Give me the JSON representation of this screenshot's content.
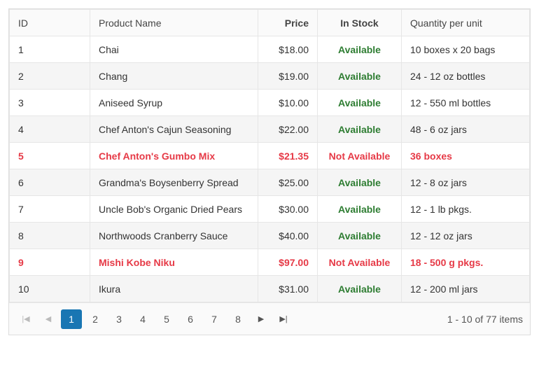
{
  "columns": {
    "id": "ID",
    "name": "Product Name",
    "price": "Price",
    "stock": "In Stock",
    "qty": "Quantity per unit"
  },
  "stock_labels": {
    "available": "Available",
    "not_available": "Not Available"
  },
  "rows": [
    {
      "id": "1",
      "name": "Chai",
      "price": "$18.00",
      "available": true,
      "qty": "10 boxes x 20 bags"
    },
    {
      "id": "2",
      "name": "Chang",
      "price": "$19.00",
      "available": true,
      "qty": "24 - 12 oz bottles"
    },
    {
      "id": "3",
      "name": "Aniseed Syrup",
      "price": "$10.00",
      "available": true,
      "qty": "12 - 550 ml bottles"
    },
    {
      "id": "4",
      "name": "Chef Anton's Cajun Seasoning",
      "price": "$22.00",
      "available": true,
      "qty": "48 - 6 oz jars"
    },
    {
      "id": "5",
      "name": "Chef Anton's Gumbo Mix",
      "price": "$21.35",
      "available": false,
      "qty": "36 boxes"
    },
    {
      "id": "6",
      "name": "Grandma's Boysenberry Spread",
      "price": "$25.00",
      "available": true,
      "qty": "12 - 8 oz jars"
    },
    {
      "id": "7",
      "name": "Uncle Bob's Organic Dried Pears",
      "price": "$30.00",
      "available": true,
      "qty": "12 - 1 lb pkgs."
    },
    {
      "id": "8",
      "name": "Northwoods Cranberry Sauce",
      "price": "$40.00",
      "available": true,
      "qty": "12 - 12 oz jars"
    },
    {
      "id": "9",
      "name": "Mishi Kobe Niku",
      "price": "$97.00",
      "available": false,
      "qty": "18 - 500 g pkgs."
    },
    {
      "id": "10",
      "name": "Ikura",
      "price": "$31.00",
      "available": true,
      "qty": "12 - 200 ml jars"
    }
  ],
  "pager": {
    "pages": [
      "1",
      "2",
      "3",
      "4",
      "5",
      "6",
      "7",
      "8"
    ],
    "current": 1,
    "info": "1 - 10 of 77 items"
  }
}
